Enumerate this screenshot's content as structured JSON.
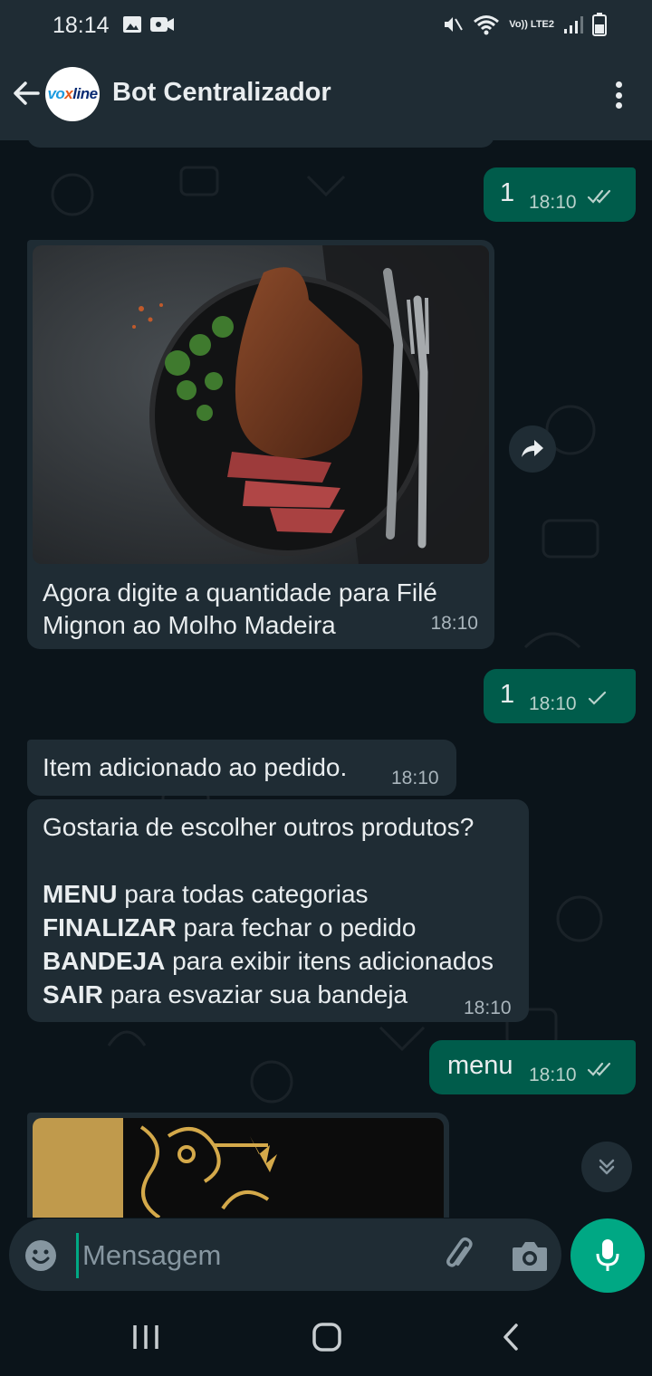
{
  "status_bar": {
    "time": "18:14",
    "network": "Vo)) LTE2"
  },
  "header": {
    "title": "Bot Centralizador",
    "avatar_text_a": "vo",
    "avatar_text_b": "x",
    "avatar_text_c": "line"
  },
  "messages": [
    {
      "dir": "out",
      "text": "1",
      "time": "18:10",
      "status": "read"
    },
    {
      "dir": "in",
      "type": "image",
      "caption": "Agora digite a quantidade para Filé Mignon ao Molho Madeira",
      "time": "18:10"
    },
    {
      "dir": "out",
      "text": "1",
      "time": "18:10",
      "status": "sent"
    },
    {
      "dir": "in",
      "text": "Item adicionado ao pedido.",
      "time": "18:10"
    },
    {
      "dir": "in",
      "intro": "Gostaria de escolher outros produtos?",
      "options": [
        {
          "key": "MENU",
          "desc": "para todas categorias"
        },
        {
          "key": "FINALIZAR",
          "desc": "para fechar o pedido"
        },
        {
          "key": "BANDEJA",
          "desc": "para exibir itens adicionados"
        },
        {
          "key": "SAIR",
          "desc": "para esvaziar sua bandeja"
        }
      ],
      "time": "18:10"
    },
    {
      "dir": "out",
      "text": "menu",
      "time": "18:10",
      "status": "read"
    }
  ],
  "composer": {
    "placeholder": "Mensagem"
  },
  "icons": {
    "back": "arrow-left-icon",
    "menu": "more-vert-icon",
    "forward": "forward-icon",
    "scroll_down": "double-chevron-down-icon",
    "emoji": "emoji-icon",
    "attach": "paperclip-icon",
    "camera": "camera-icon",
    "mic": "mic-icon"
  },
  "colors": {
    "header": "#1f2c34",
    "background": "#0b141a",
    "incoming": "#1f2c34",
    "outgoing": "#005c4b",
    "accent": "#00a884",
    "read_tick": "#b8d1cb"
  }
}
